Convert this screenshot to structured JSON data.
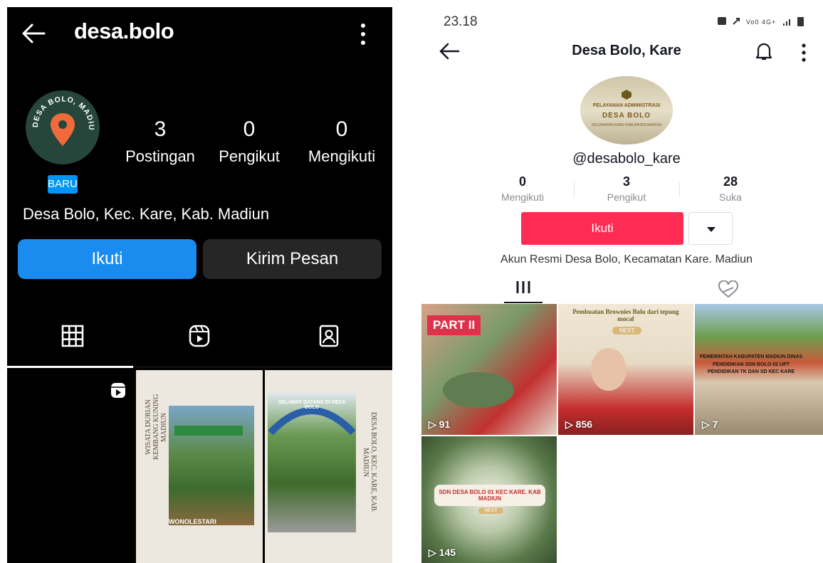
{
  "instagram": {
    "username": "desa.bolo",
    "avatar_text": "DESA BOLO, MADIUN",
    "new_badge": "BARU",
    "stats": [
      {
        "count": "3",
        "label": "Postingan"
      },
      {
        "count": "0",
        "label": "Pengikut"
      },
      {
        "count": "0",
        "label": "Mengikuti"
      }
    ],
    "bio": "Desa Bolo, Kec. Kare, Kab. Madiun",
    "follow_label": "Ikuti",
    "message_label": "Kirim Pesan",
    "posts": [
      {
        "caption": "WISATA DURIAN KEMBANG KUNING MADIUN",
        "tag": "WONOLESTARI"
      },
      {
        "caption": "DESA BOLO, KEC. KARE, KAB. MADIUN",
        "sign": "SELAMAT DATANG DI DESA BOLO"
      }
    ],
    "colors": {
      "accent": "#1a8cf0",
      "background": "#000000",
      "avatar_bg": "#26463c",
      "pin": "#f16a3b"
    }
  },
  "tiktok": {
    "status_time": "23.18",
    "status_icons": "VoLTE 4G+ signal battery",
    "title": "Desa Bolo, Kare",
    "avatar_sign": [
      "PELAYANAN ADMINISTRASI",
      "DESA BOLO",
      "KECAMATAN KARE KABUPATEN MADIUN"
    ],
    "handle": "@desabolo_kare",
    "stats": [
      {
        "count": "0",
        "label": "Mengikuti"
      },
      {
        "count": "3",
        "label": "Pengikut"
      },
      {
        "count": "28",
        "label": "Suka"
      }
    ],
    "follow_label": "Ikuti",
    "bio": "Akun Resmi Desa Bolo, Kecamatan Kare. Madiun",
    "videos": [
      {
        "views": "91",
        "overlay": "PART II"
      },
      {
        "views": "856",
        "overlay": "Pembuatan Brownies Bolu dari tepung mocaf",
        "button": "NEXT"
      },
      {
        "views": "7",
        "overlay": "PEMERINTAH KABUPATEN MADIUN DINAS PENDIDIKAN SDN BOLO 02 UPT PENDIDIKAN TK DAN SD KEC KARE"
      },
      {
        "views": "145",
        "overlay": "SDN DESA BOLO 01 KEC KARE. KAB MADIUN",
        "button": "NEXT"
      }
    ],
    "colors": {
      "follow": "#fe2c55",
      "text": "#161823",
      "muted": "#8a8b91"
    }
  }
}
